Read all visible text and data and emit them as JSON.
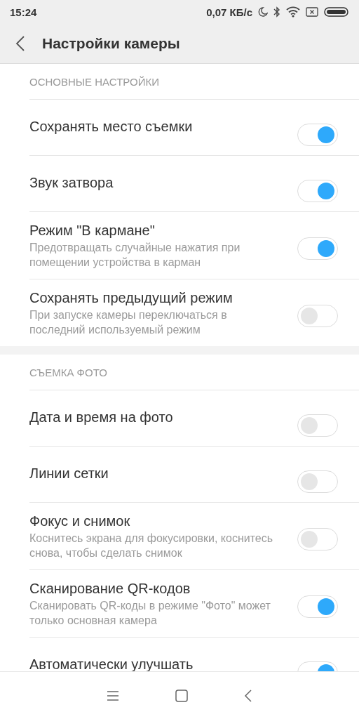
{
  "status_bar": {
    "time": "15:24",
    "speed": "0,07 КБ/с"
  },
  "header": {
    "title": "Настройки камеры"
  },
  "sections": [
    {
      "title": "ОСНОВНЫЕ НАСТРОЙКИ",
      "items": [
        {
          "title": "Сохранять место съемки",
          "on": true
        },
        {
          "title": "Звук затвора",
          "on": true
        },
        {
          "title": "Режим \"В кармане\"",
          "subtitle": "Предотвращать случайные нажатия при помещении устройства в карман",
          "on": true
        },
        {
          "title": "Сохранять предыдущий режим",
          "subtitle": "При запуске камеры переключаться в последний используемый режим",
          "on": false
        }
      ]
    },
    {
      "title": "СЪЕМКА ФОТО",
      "items": [
        {
          "title": "Дата и время на фото",
          "on": false
        },
        {
          "title": "Линии сетки",
          "on": false
        },
        {
          "title": "Фокус и снимок",
          "subtitle": "Коснитесь экрана для фокусировки, коснитесь снова, чтобы сделать снимок",
          "on": false
        },
        {
          "title": "Сканирование QR-кодов",
          "subtitle": "Сканировать QR-коды в режиме \"Фото\" может только основная камера",
          "on": true
        },
        {
          "title": "Автоматически улучшать",
          "on": true
        }
      ]
    }
  ]
}
